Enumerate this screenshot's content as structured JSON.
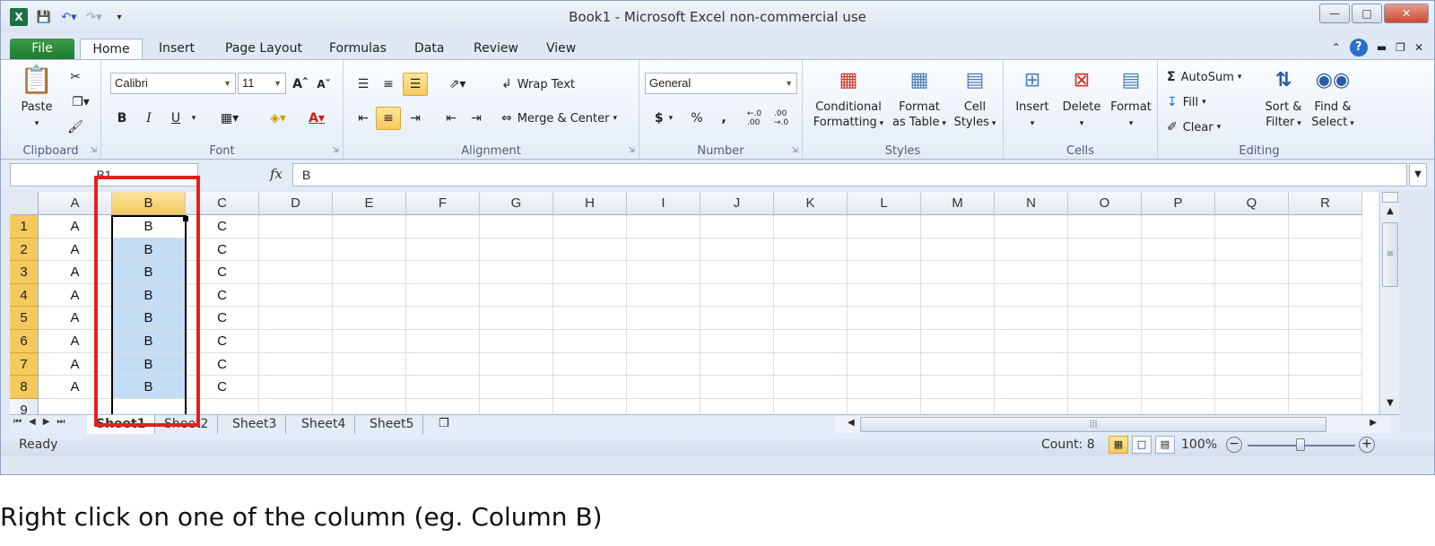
{
  "window": {
    "title": "Book1  -  Microsoft Excel non-commercial use",
    "qat_icons": [
      "excel-logo",
      "save-icon",
      "undo-icon",
      "redo-icon",
      "customize-icon"
    ],
    "logo_text": "X"
  },
  "tabs": {
    "file": "File",
    "home": "Home",
    "insert": "Insert",
    "page_layout": "Page Layout",
    "formulas": "Formulas",
    "data": "Data",
    "review": "Review",
    "view": "View"
  },
  "ribbon": {
    "clipboard": {
      "label": "Clipboard",
      "paste": "Paste"
    },
    "font": {
      "label": "Font",
      "name": "Calibri",
      "size": "11",
      "bold": "B",
      "italic": "I",
      "underline": "U"
    },
    "alignment": {
      "label": "Alignment",
      "wrap_text": "Wrap Text",
      "merge_center": "Merge & Center"
    },
    "number": {
      "label": "Number",
      "format": "General",
      "currency": "$",
      "percent": "%",
      "comma": ",",
      "inc_decimal": "←.0 .00",
      "dec_decimal": ".00 →.0"
    },
    "styles": {
      "label": "Styles",
      "conditional_1": "Conditional",
      "conditional_2": "Formatting",
      "format_table_1": "Format",
      "format_table_2": "as Table",
      "cell_styles_1": "Cell",
      "cell_styles_2": "Styles"
    },
    "cells": {
      "label": "Cells",
      "insert": "Insert",
      "delete": "Delete",
      "format": "Format"
    },
    "editing": {
      "label": "Editing",
      "autosum": "AutoSum",
      "fill": "Fill",
      "clear": "Clear",
      "sort_1": "Sort &",
      "sort_2": "Filter",
      "find_1": "Find &",
      "find_2": "Select"
    }
  },
  "formula_bar": {
    "name_box": "B1",
    "fx": "fx",
    "value": "B"
  },
  "grid": {
    "columns": [
      "A",
      "B",
      "C",
      "D",
      "E",
      "F",
      "G",
      "H",
      "I",
      "J",
      "K",
      "L",
      "M",
      "N",
      "O",
      "P",
      "Q",
      "R"
    ],
    "selected_column": "B",
    "rows": [
      {
        "num": "1",
        "a": "A",
        "b": "B",
        "c": "C"
      },
      {
        "num": "2",
        "a": "A",
        "b": "B",
        "c": "C"
      },
      {
        "num": "3",
        "a": "A",
        "b": "B",
        "c": "C"
      },
      {
        "num": "4",
        "a": "A",
        "b": "B",
        "c": "C"
      },
      {
        "num": "5",
        "a": "A",
        "b": "B",
        "c": "C"
      },
      {
        "num": "6",
        "a": "A",
        "b": "B",
        "c": "C"
      },
      {
        "num": "7",
        "a": "A",
        "b": "B",
        "c": "C"
      },
      {
        "num": "8",
        "a": "A",
        "b": "B",
        "c": "C"
      },
      {
        "num": "9",
        "a": "",
        "b": "",
        "c": ""
      }
    ]
  },
  "sheets": [
    "Sheet1",
    "Sheet2",
    "Sheet3",
    "Sheet4",
    "Sheet5"
  ],
  "status": {
    "ready": "Ready",
    "count": "Count: 8",
    "zoom": "100%"
  },
  "colors": {
    "selection_highlight": "#c5dcf5",
    "header_highlight": "#f4c95d",
    "annotation_red": "#e8201c",
    "file_tab_green": "#2e8b3e"
  },
  "caption": "Right click on one of the column (eg. Column B)"
}
